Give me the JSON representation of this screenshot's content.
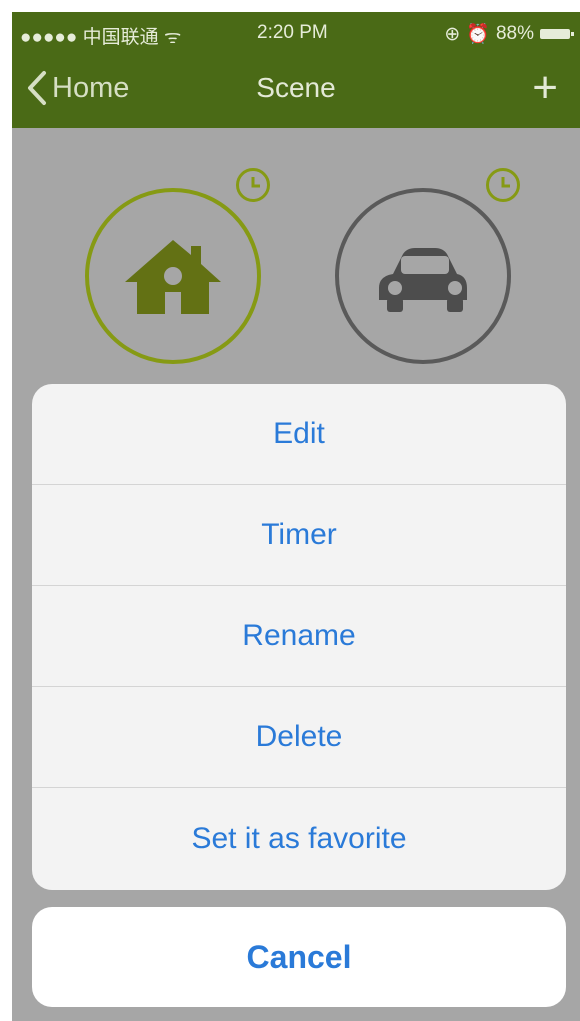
{
  "status_bar": {
    "carrier": "●●●●● 中国联通 ᯤ",
    "time": "2:20 PM",
    "battery": "88%"
  },
  "nav": {
    "back_label": "Home",
    "title": "Scene",
    "add_symbol": "+"
  },
  "scenes": [
    {
      "icon": "home-icon",
      "active": true
    },
    {
      "icon": "car-icon",
      "active": false
    }
  ],
  "action_sheet": {
    "items": [
      "Edit",
      "Timer",
      "Rename",
      "Delete",
      "Set it as favorite"
    ],
    "cancel": "Cancel"
  },
  "colors": {
    "nav_bg": "#4a6a16",
    "accent_green": "#869a14",
    "action_blue": "#2a7ad8",
    "dim_overlay": "#a6a6a6"
  }
}
